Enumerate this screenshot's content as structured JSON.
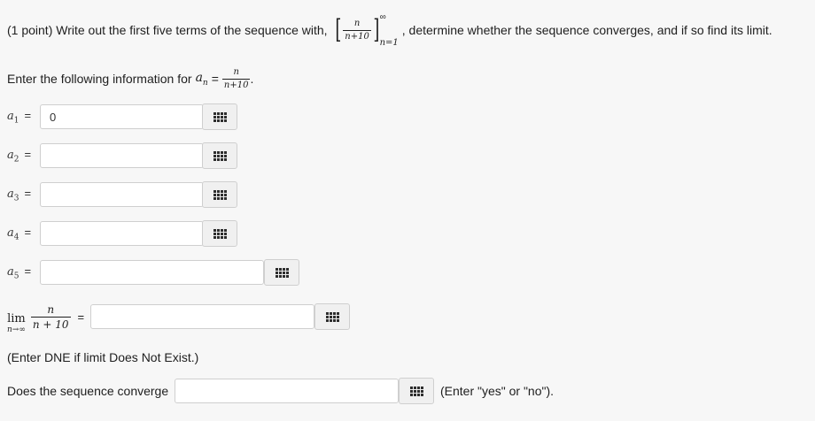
{
  "question": {
    "prefix": "(1 point) Write out the first five terms of the sequence with,",
    "fraction_num": "n",
    "fraction_den": "n+10",
    "sup": "∞",
    "sub": "n=1",
    "suffix": ", determine whether the sequence converges, and if so find its limit."
  },
  "instruction": {
    "text": "Enter the following information for",
    "var": "a",
    "var_sub": "n",
    "eq": "=",
    "num": "n",
    "den": "n+10",
    "end": "."
  },
  "terms": [
    {
      "base": "a",
      "sub": "1",
      "eq": "=",
      "value": "0"
    },
    {
      "base": "a",
      "sub": "2",
      "eq": "=",
      "value": ""
    },
    {
      "base": "a",
      "sub": "3",
      "eq": "=",
      "value": ""
    },
    {
      "base": "a",
      "sub": "4",
      "eq": "=",
      "value": ""
    },
    {
      "base": "a",
      "sub": "5",
      "eq": "=",
      "value": ""
    }
  ],
  "limit": {
    "lim": "lim",
    "sub": "n→∞",
    "num": "n",
    "den": "n + 10",
    "eq": "=",
    "value": ""
  },
  "dne_note": "(Enter DNE if limit Does Not Exist.)",
  "converge": {
    "label": "Does the sequence converge",
    "value": "",
    "hint": "(Enter \"yes\" or \"no\")."
  },
  "icons": {
    "keypad": "keypad-icon"
  }
}
